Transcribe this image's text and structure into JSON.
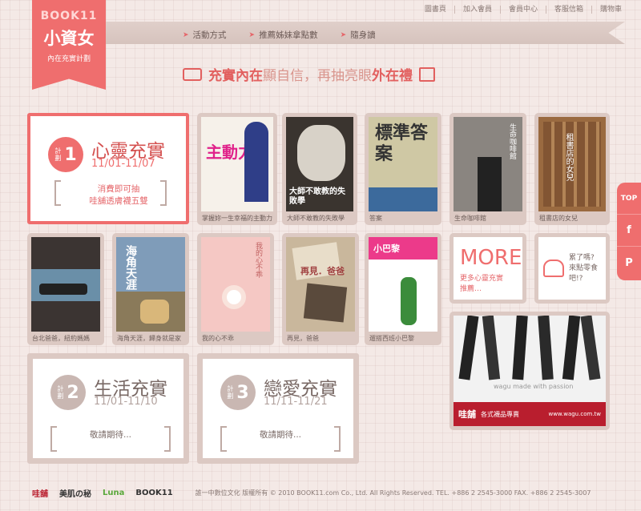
{
  "topnav": [
    "圖書頁",
    "加入會員",
    "會員中心",
    "客服信箱",
    "購物車"
  ],
  "logo": {
    "brand": "BOOK11",
    "title": "小資女",
    "subtitle": "內在充實計劃"
  },
  "menu": [
    "活動方式",
    "推薦姊妹拿點數",
    "隨身讀"
  ],
  "slogan": {
    "part1": "充實內在",
    "part2": "顯自信，再抽亮眼",
    "part3": "外在禮"
  },
  "plan1": {
    "label": "計劃",
    "num": "1",
    "title": "心靈充實",
    "date": "11/01-11/07",
    "line1": "消費即可抽",
    "line2": "哇舖透膚襪五雙"
  },
  "plan2": {
    "label": "計劃",
    "num": "2",
    "title": "生活充實",
    "date": "11/01-11/10",
    "wait": "敬請期待..."
  },
  "plan3": {
    "label": "計劃",
    "num": "3",
    "title": "戀愛充實",
    "date": "11/11-11/21",
    "wait": "敬請期待..."
  },
  "books_row1": [
    {
      "caption": "掌握妳一生幸福的主動力",
      "cover_text": "主動力",
      "color": "#f6f1ea"
    },
    {
      "caption": "大師不敢教的失敗學",
      "cover_text": "大師不敢教的失敗學",
      "color": "#3a342f"
    },
    {
      "caption": "答案",
      "cover_text": "標準答案",
      "color": "#cfc8a4"
    },
    {
      "caption": "生命咖啡館",
      "cover_text": "生命咖啡館",
      "color": "#8a8580"
    },
    {
      "caption": "租書店的女兒",
      "cover_text": "租書店的女兒",
      "color": "#9a6a40"
    }
  ],
  "books_row2": [
    {
      "caption": "台北爸爸，紐約媽媽",
      "cover_text": "",
      "color": "#3b3432"
    },
    {
      "caption": "海角天涯，歸身就是家",
      "cover_text": "海角天涯",
      "color": "#7f9cb9"
    },
    {
      "caption": "我的心不乖",
      "cover_text": "我的心不乖",
      "color": "#f5c8c4"
    },
    {
      "caption": "再見，爸爸",
      "cover_text": "再見．爸爸",
      "color": "#c9b79c"
    },
    {
      "caption": "遛搭西班小巴黎",
      "cover_text": "小巴黎",
      "color": "#ffffff"
    }
  ],
  "more": {
    "title": "MORE",
    "sub": "更多心靈充實\n推薦…"
  },
  "snack": {
    "text": "累了嗎?\n來點零食吧!?"
  },
  "ad": {
    "caption": "wagu made with passion",
    "brand": "哇舖",
    "tag": "各式襪品專賣",
    "url": "www.wagu.com.tw"
  },
  "side": [
    "TOP",
    "f",
    "P"
  ],
  "footer": {
    "logos": [
      "哇舖",
      "美肌の秘",
      "Luna",
      "BOOK11"
    ],
    "copy": "誰一中數位文化 版權所有 © 2010 BOOK11.com Co., Ltd. All Rights Reserved.    TEL. +886 2 2545-3000    FAX. +886 2 2545-3007"
  }
}
